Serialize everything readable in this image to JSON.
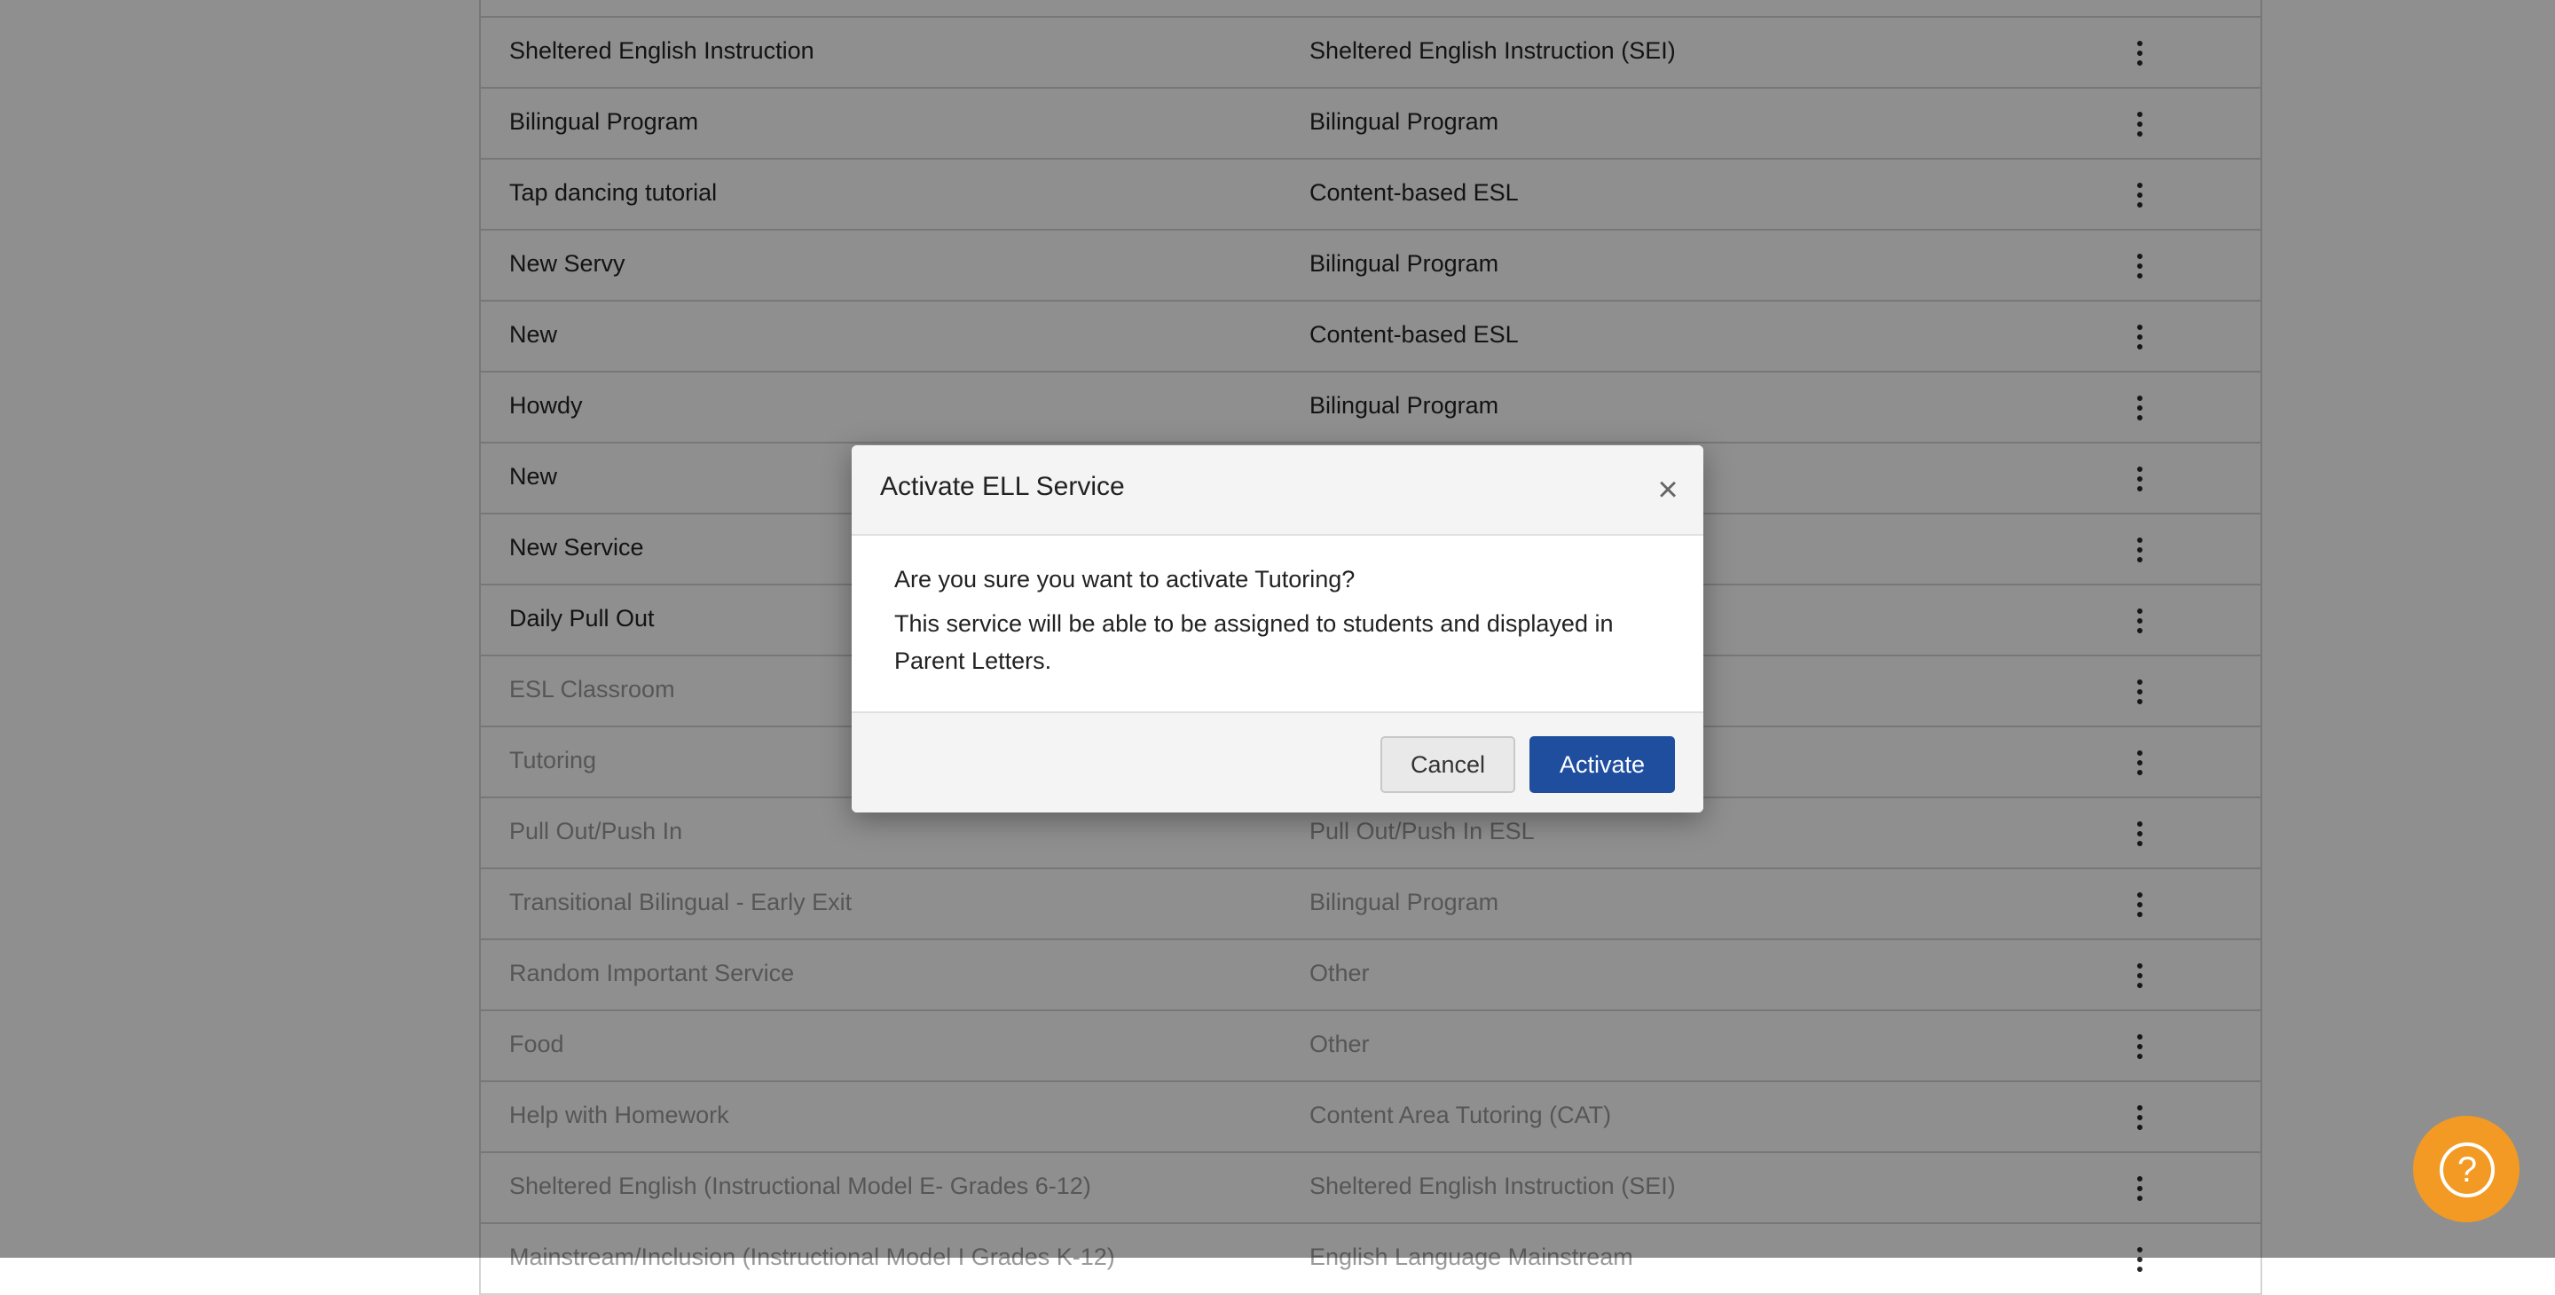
{
  "services_table": {
    "rows": [
      {
        "name": "Sheltered English Instruction",
        "type": "Sheltered English Instruction (SEI)",
        "active": true
      },
      {
        "name": "Bilingual Program",
        "type": "Bilingual Program",
        "active": true
      },
      {
        "name": "Tap dancing tutorial",
        "type": "Content-based ESL",
        "active": true
      },
      {
        "name": "New Servy",
        "type": "Bilingual Program",
        "active": true
      },
      {
        "name": "New",
        "type": "Content-based ESL",
        "active": true
      },
      {
        "name": "Howdy",
        "type": "Bilingual Program",
        "active": true
      },
      {
        "name": "New",
        "type": "",
        "active": true
      },
      {
        "name": "New Service",
        "type": "",
        "active": true
      },
      {
        "name": "Daily Pull Out",
        "type": "",
        "active": true
      },
      {
        "name": "ESL Classroom",
        "type": "",
        "active": false
      },
      {
        "name": "Tutoring",
        "type": "",
        "active": false
      },
      {
        "name": "Pull Out/Push In",
        "type": "Pull Out/Push In ESL",
        "active": false
      },
      {
        "name": "Transitional Bilingual - Early Exit",
        "type": "Bilingual Program",
        "active": false
      },
      {
        "name": "Random Important Service",
        "type": "Other",
        "active": false
      },
      {
        "name": "Food",
        "type": "Other",
        "active": false
      },
      {
        "name": "Help with Homework",
        "type": "Content Area Tutoring (CAT)",
        "active": false
      },
      {
        "name": "Sheltered English (Instructional Model E- Grades 6-12)",
        "type": "Sheltered English Instruction (SEI)",
        "active": false
      },
      {
        "name": "Mainstream/Inclusion (Instructional Model I Grades K-12)",
        "type": "English Language Mainstream",
        "active": false
      }
    ]
  },
  "modal": {
    "title": "Activate ELL Service",
    "close_symbol": "×",
    "question": "Are you sure you want to activate Tutoring?",
    "description": "This service will be able to be assigned to students and displayed in Parent Letters.",
    "cancel_label": "Cancel",
    "activate_label": "Activate"
  },
  "help_button": {
    "symbol": "?"
  },
  "colors": {
    "accent_primary": "#1f4e9f",
    "help_orange": "#f39a24",
    "overlay": "rgba(0,0,0,0.44)",
    "inactive_text": "#9a9a9a"
  }
}
